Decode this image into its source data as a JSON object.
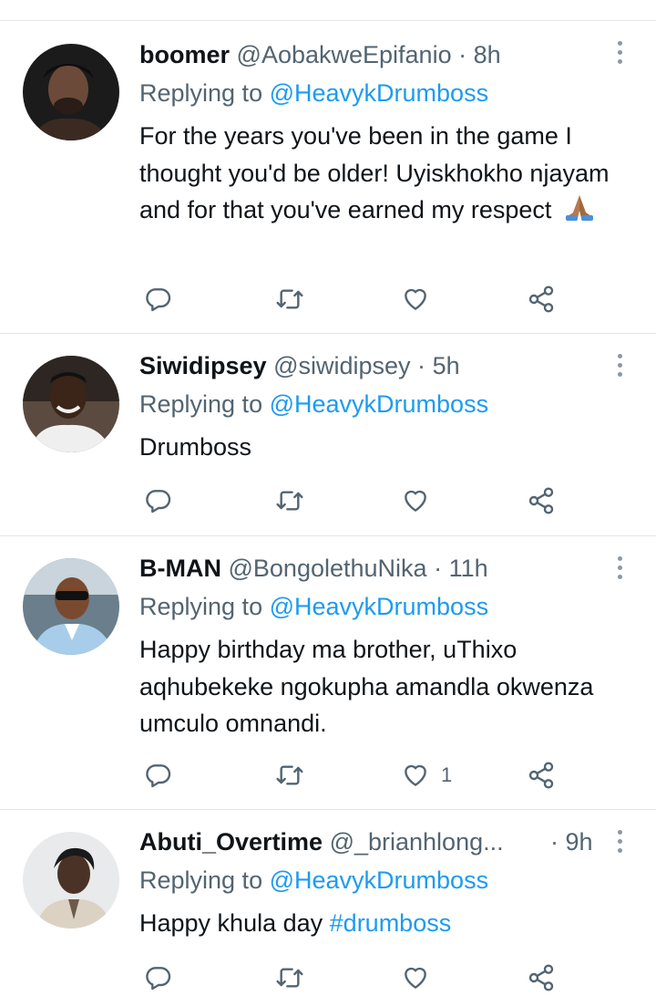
{
  "tweets": [
    {
      "name": "boomer",
      "handle": "@AobakweEpifanio",
      "dot": "·",
      "time": "8h",
      "replying_prefix": "Replying to",
      "replying_to": "@HeavykDrumboss",
      "text": "For the years you've been in the game I thought you'd be older! Uyiskhokho njayam and for that you've earned my respect",
      "emoji": "folded-hands-emoji",
      "likes": ""
    },
    {
      "name": "Siwidipsey",
      "handle": "@siwidipsey",
      "dot": "·",
      "time": "5h",
      "replying_prefix": "Replying to",
      "replying_to": "@HeavykDrumboss",
      "text": "Drumboss",
      "likes": ""
    },
    {
      "name": "B-MAN",
      "handle": "@BongolethuNika",
      "dot": "·",
      "time": "11h",
      "replying_prefix": "Replying to",
      "replying_to": "@HeavykDrumboss",
      "text": "Happy birthday ma brother, uThixo aqhubekeke ngokupha amandla okwenza umculo omnandi.",
      "likes": "1"
    },
    {
      "name": "Abuti_Overtime",
      "handle": "@_brianhlong...",
      "dot": "·",
      "time": "9h",
      "replying_prefix": "Replying to",
      "replying_to": "@HeavykDrumboss",
      "text_plain": "Happy khula day",
      "hashtag": "#drumboss",
      "likes": ""
    }
  ],
  "icons": [
    "reply-icon",
    "retweet-icon",
    "like-icon",
    "share-icon",
    "more-options-icon"
  ],
  "colors": {
    "link": "#1d9bf0",
    "secondary": "#536471",
    "text": "#0f1419",
    "icon": "#536471"
  }
}
